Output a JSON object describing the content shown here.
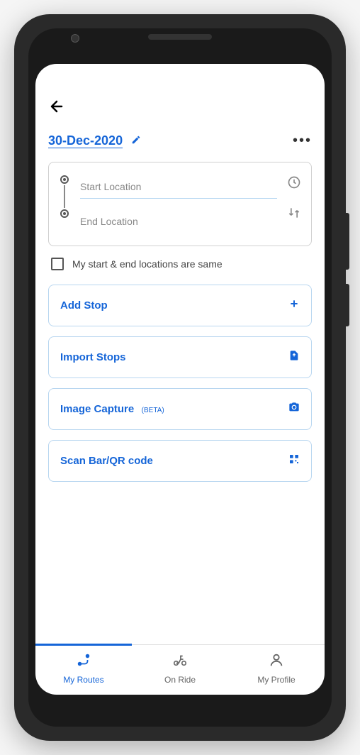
{
  "header": {
    "date": "30-Dec-2020"
  },
  "locations": {
    "start_placeholder": "Start Location",
    "end_placeholder": "End Location",
    "same_label": "My start & end locations are same"
  },
  "actions": {
    "add_stop": "Add Stop",
    "import_stops": "Import Stops",
    "image_capture": "Image Capture",
    "image_capture_beta": "(BETA)",
    "scan_code": "Scan Bar/QR code"
  },
  "nav": {
    "my_routes": "My Routes",
    "on_ride": "On Ride",
    "my_profile": "My Profile"
  }
}
